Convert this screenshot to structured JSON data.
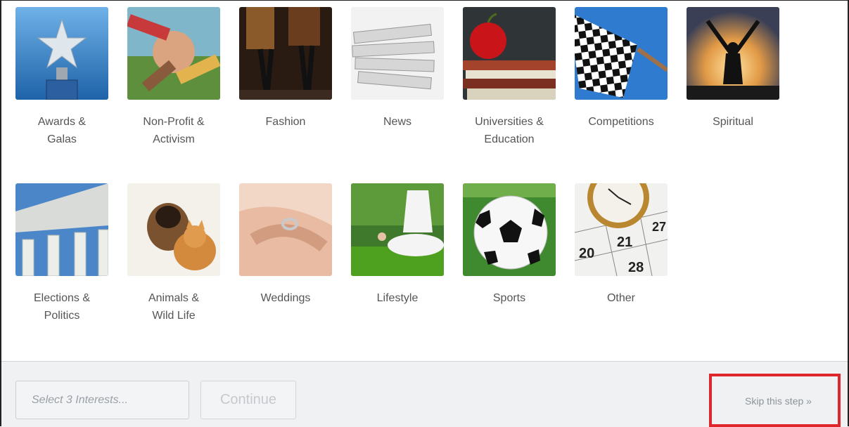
{
  "interests": [
    {
      "label": "Awards &\nGalas",
      "icon": "award-star-trophy"
    },
    {
      "label": "Non-Profit &\nActivism",
      "icon": "stacked-hands"
    },
    {
      "label": "Fashion",
      "icon": "runway-legs"
    },
    {
      "label": "News",
      "icon": "newspapers"
    },
    {
      "label": "Universities &\nEducation",
      "icon": "apple-on-books"
    },
    {
      "label": "Competitions",
      "icon": "checkered-flag"
    },
    {
      "label": "Spiritual",
      "icon": "meditation-silhouette"
    },
    {
      "label": "Elections &\nPolitics",
      "icon": "government-building"
    },
    {
      "label": "Animals &\nWild Life",
      "icon": "dog-and-cat"
    },
    {
      "label": "Weddings",
      "icon": "ring-on-hand"
    },
    {
      "label": "Lifestyle",
      "icon": "yoga-on-grass"
    },
    {
      "label": "Sports",
      "icon": "soccer-ball"
    },
    {
      "label": "Other",
      "icon": "clock-calendar"
    }
  ],
  "footer": {
    "interest_placeholder": "Select 3 Interests...",
    "continue_label": "Continue",
    "skip_label": "Skip this step »"
  },
  "colors": {
    "highlight_border": "#e0262d",
    "footer_bg": "#f0f1f3"
  }
}
